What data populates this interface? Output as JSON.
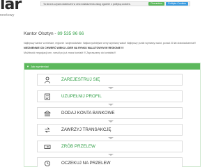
{
  "logo": {
    "text": "lar",
    "subtitle": "nnetowy"
  },
  "cookie": {
    "text": "Ta strona używa ciasteczek w celu świadczenia usług zgodnie z polityką cookies.",
    "accept": "Rozumiem",
    "policy": "Polityka Cookies"
  },
  "page": {
    "title": "Kantor Olsztyn - ",
    "phone": "89 535 96 66",
    "lines": [
      "Najlepszy kantor w mieście, regionie i województwie. Najkorzystniejsze ceny wymiany walut! Najlepszy punkt wymiany walut, ponad 20 lat doświadczenia!!!",
      "NIEZNIENNIE OD CHWERĆ WIEKU LIDER NA RYNKU WALUTOWYM W REGIONIE !!!",
      "Możliwość negocjacji cen, wesół po już znasz kontakt !!! Zapraszamy do kontaktu!!!"
    ]
  },
  "panel": {
    "title": "Jak wymieniać",
    "steps": [
      {
        "label": "ZAREJESTRUJ SIĘ",
        "icon": "user-icon"
      },
      {
        "label": "UZUPEŁNIJ PROFIL",
        "icon": "checklist-icon"
      },
      {
        "label": "DODAJ KONTA BANKOWE",
        "icon": "bank-icon"
      },
      {
        "label": "ZAWRZYJ TRANSAKCJĘ",
        "icon": "exchange-icon"
      },
      {
        "label": "ZRÓB PRZELEW",
        "icon": "transfer-icon"
      },
      {
        "label": "OCZEKUJ NA PRZELEW",
        "icon": "clock-icon"
      }
    ]
  },
  "colors": {
    "accent": "#5cb85c",
    "link": "#2f9e44"
  }
}
